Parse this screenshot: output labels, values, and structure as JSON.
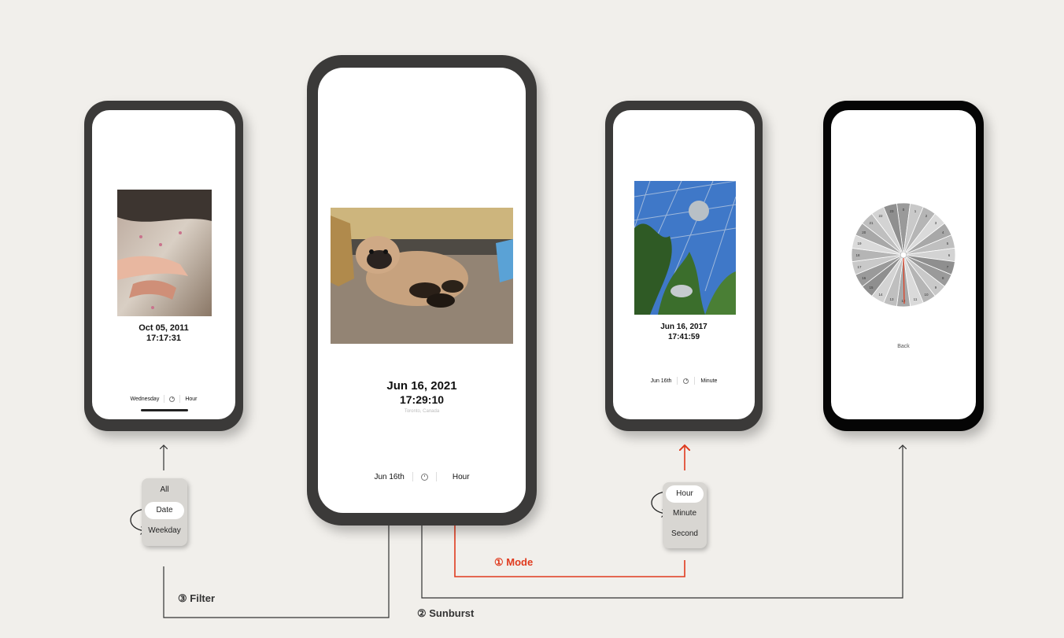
{
  "colors": {
    "accent": "#e03a1e",
    "background": "#f1efeb",
    "phone_frame": "#3b3a39",
    "line": "#222222"
  },
  "phone_left": {
    "date": "Oct 05, 2011",
    "time": "17:17:31",
    "location": "",
    "bar": {
      "left": "Wednesday",
      "icon": "clock-icon",
      "right": "Hour"
    }
  },
  "phone_center": {
    "date": "Jun 16, 2021",
    "time": "17:29:10",
    "location": "Toronto, Canada",
    "bar": {
      "left": "Jun 16th",
      "icon": "clock-icon",
      "right": "Hour"
    }
  },
  "phone_right": {
    "date": "Jun 16, 2017",
    "time": "17:41:59",
    "location": "",
    "bar": {
      "left": "Jun 16th",
      "icon": "clock-icon",
      "right": "Minute"
    }
  },
  "phone_sunburst": {
    "back_label": "Back",
    "hour_labels": [
      "0",
      "1",
      "2",
      "3",
      "4",
      "5",
      "6",
      "7",
      "8",
      "9",
      "10",
      "11",
      "12",
      "13",
      "14",
      "15",
      "16",
      "17",
      "18",
      "19",
      "20",
      "21",
      "22",
      "23"
    ]
  },
  "filter_menu": {
    "options": [
      "All",
      "Date",
      "Weekday"
    ],
    "selected": "Date"
  },
  "mode_menu": {
    "options": [
      "Hour",
      "Minute",
      "Second"
    ],
    "selected": "Hour"
  },
  "annotations": {
    "mode": "① Mode",
    "sunburst": "② Sunburst",
    "filter": "③ Filter"
  }
}
